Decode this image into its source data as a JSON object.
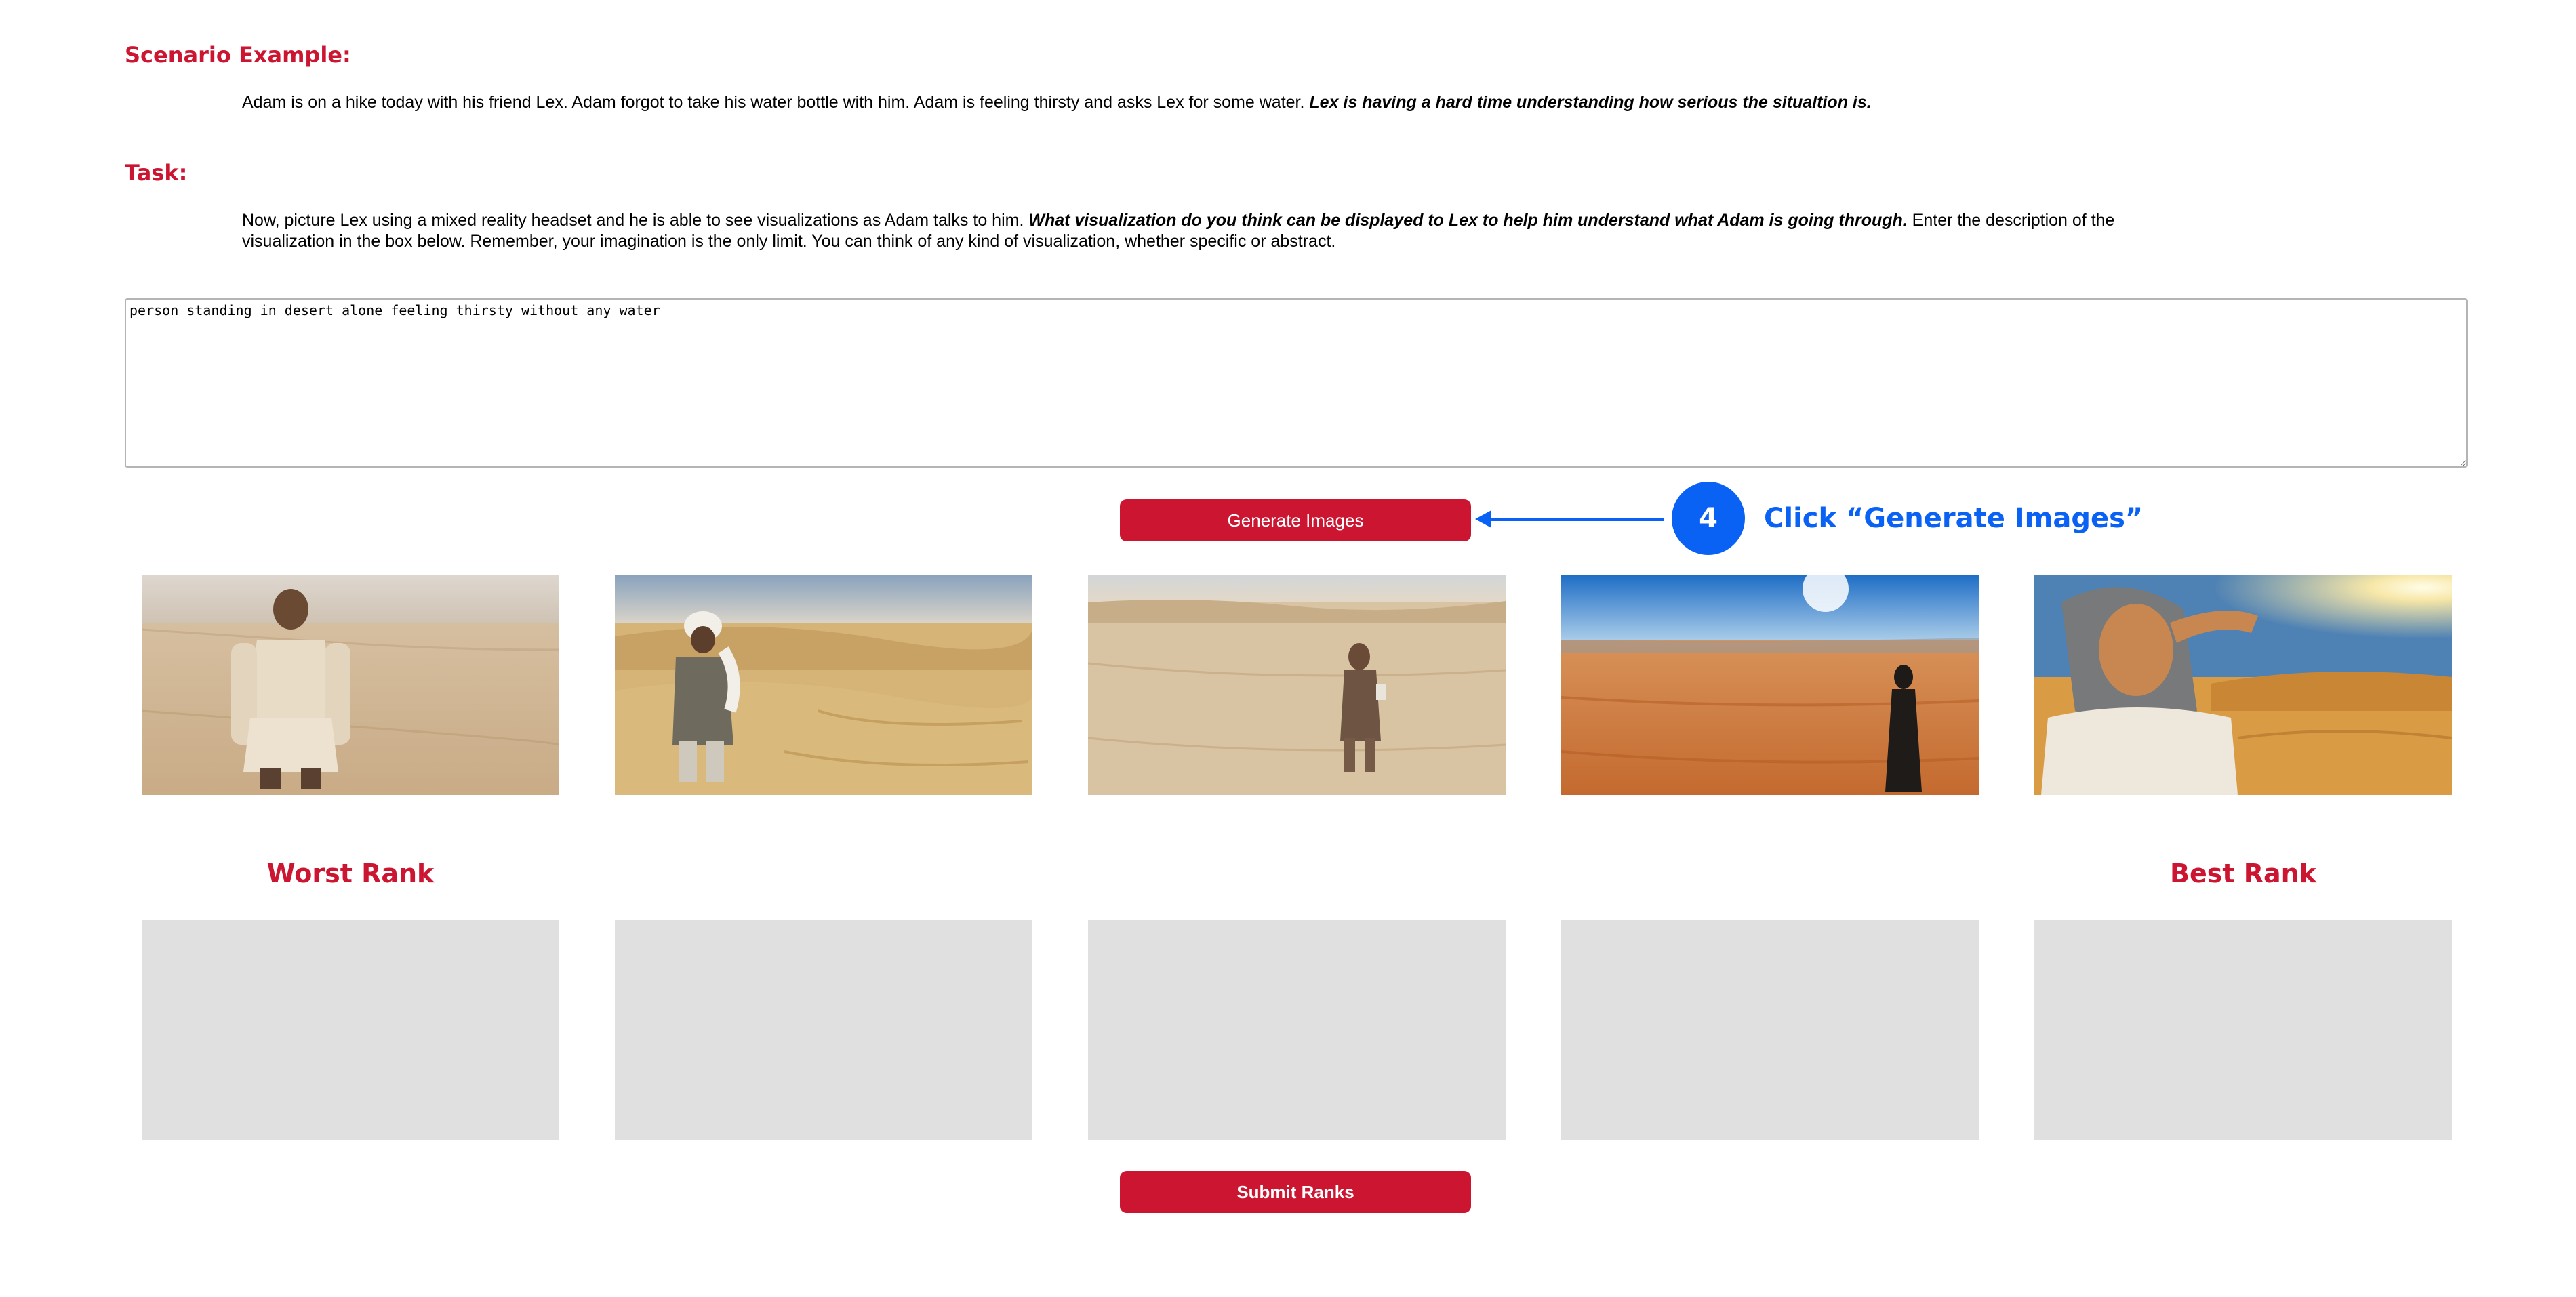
{
  "scenario": {
    "heading": "Scenario Example:",
    "text": "Adam is on a hike today with his friend Lex. Adam forgot to take his water bottle with him. Adam is feeling thirsty and asks Lex for some water. ",
    "emphasis": "Lex is having a hard time understanding how serious the situaltion is."
  },
  "task": {
    "heading": "Task:",
    "text_before": "Now, picture Lex using a mixed reality headset and he is able to see visualizations as Adam talks to him. ",
    "emphasis": "What visualization do you think can be displayed to Lex to help him understand what Adam is going through.",
    "text_after": " Enter the description of the visualization in the box below. Remember, your imagination is the only limit. You can think of any kind of visualization, whether specific or abstract."
  },
  "description_input": {
    "value": "person standing in desert alone feeling thirsty without any water"
  },
  "buttons": {
    "generate_label": "Generate Images",
    "submit_label": "Submit Ranks"
  },
  "callout": {
    "step": "4",
    "text": "Click “Generate Images”",
    "color": "#0a62f5"
  },
  "generated_images": [
    {
      "subject": "man in beige clothing standing in desert"
    },
    {
      "subject": "man with head wrap standing on sand dunes"
    },
    {
      "subject": "figure in brown robe standing in desert"
    },
    {
      "subject": "figure in dark robe on desert under blue sky"
    },
    {
      "subject": "woman in headscarf shielding eyes from sun in desert"
    }
  ],
  "ranking": {
    "worst_label": "Worst Rank",
    "best_label": "Best Rank",
    "slot_count": 5
  },
  "colors": {
    "accent_red": "#cc1530",
    "callout_blue": "#0a62f5",
    "slot_gray": "#e0e0e0"
  }
}
